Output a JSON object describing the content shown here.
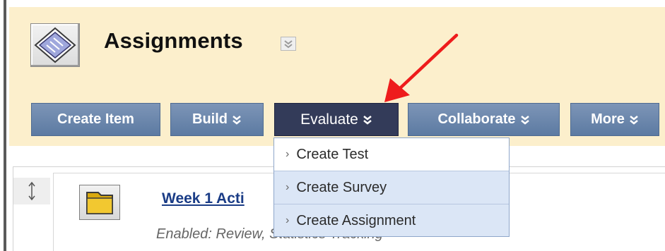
{
  "header": {
    "title": "Assignments"
  },
  "action_bar": {
    "create_item": "Create Item",
    "build": "Build",
    "evaluate": "Evaluate",
    "collaborate": "Collaborate",
    "more": "More"
  },
  "evaluate_menu": {
    "items": [
      {
        "label": "Create Test"
      },
      {
        "label": "Create Survey"
      },
      {
        "label": "Create Assignment"
      }
    ]
  },
  "content_item": {
    "title": "Week 1 Acti",
    "meta": "Enabled: Review, Statistics Tracking"
  },
  "colors": {
    "header_band": "#fcefcc",
    "button_blue": "#6984ab",
    "button_active": "#333b59",
    "menu_highlight": "#dbe6f6",
    "annotation_arrow": "#ee1c1c"
  },
  "icons": [
    "assignments-page-icon",
    "title-chevron-icon",
    "double-chevron-down-icon",
    "drag-handle-icon",
    "folder-icon",
    "menu-chevron-icon",
    "red-annotation-arrow"
  ]
}
